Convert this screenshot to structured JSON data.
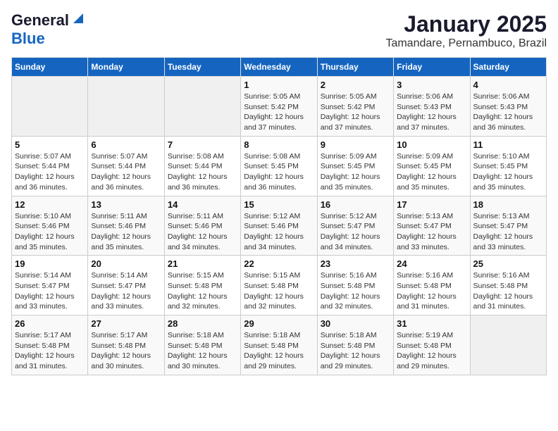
{
  "header": {
    "logo_line1": "General",
    "logo_line2": "Blue",
    "month": "January 2025",
    "location": "Tamandare, Pernambuco, Brazil"
  },
  "weekdays": [
    "Sunday",
    "Monday",
    "Tuesday",
    "Wednesday",
    "Thursday",
    "Friday",
    "Saturday"
  ],
  "weeks": [
    [
      {
        "day": "",
        "info": ""
      },
      {
        "day": "",
        "info": ""
      },
      {
        "day": "",
        "info": ""
      },
      {
        "day": "1",
        "info": "Sunrise: 5:05 AM\nSunset: 5:42 PM\nDaylight: 12 hours\nand 37 minutes."
      },
      {
        "day": "2",
        "info": "Sunrise: 5:05 AM\nSunset: 5:42 PM\nDaylight: 12 hours\nand 37 minutes."
      },
      {
        "day": "3",
        "info": "Sunrise: 5:06 AM\nSunset: 5:43 PM\nDaylight: 12 hours\nand 37 minutes."
      },
      {
        "day": "4",
        "info": "Sunrise: 5:06 AM\nSunset: 5:43 PM\nDaylight: 12 hours\nand 36 minutes."
      }
    ],
    [
      {
        "day": "5",
        "info": "Sunrise: 5:07 AM\nSunset: 5:44 PM\nDaylight: 12 hours\nand 36 minutes."
      },
      {
        "day": "6",
        "info": "Sunrise: 5:07 AM\nSunset: 5:44 PM\nDaylight: 12 hours\nand 36 minutes."
      },
      {
        "day": "7",
        "info": "Sunrise: 5:08 AM\nSunset: 5:44 PM\nDaylight: 12 hours\nand 36 minutes."
      },
      {
        "day": "8",
        "info": "Sunrise: 5:08 AM\nSunset: 5:45 PM\nDaylight: 12 hours\nand 36 minutes."
      },
      {
        "day": "9",
        "info": "Sunrise: 5:09 AM\nSunset: 5:45 PM\nDaylight: 12 hours\nand 35 minutes."
      },
      {
        "day": "10",
        "info": "Sunrise: 5:09 AM\nSunset: 5:45 PM\nDaylight: 12 hours\nand 35 minutes."
      },
      {
        "day": "11",
        "info": "Sunrise: 5:10 AM\nSunset: 5:45 PM\nDaylight: 12 hours\nand 35 minutes."
      }
    ],
    [
      {
        "day": "12",
        "info": "Sunrise: 5:10 AM\nSunset: 5:46 PM\nDaylight: 12 hours\nand 35 minutes."
      },
      {
        "day": "13",
        "info": "Sunrise: 5:11 AM\nSunset: 5:46 PM\nDaylight: 12 hours\nand 35 minutes."
      },
      {
        "day": "14",
        "info": "Sunrise: 5:11 AM\nSunset: 5:46 PM\nDaylight: 12 hours\nand 34 minutes."
      },
      {
        "day": "15",
        "info": "Sunrise: 5:12 AM\nSunset: 5:46 PM\nDaylight: 12 hours\nand 34 minutes."
      },
      {
        "day": "16",
        "info": "Sunrise: 5:12 AM\nSunset: 5:47 PM\nDaylight: 12 hours\nand 34 minutes."
      },
      {
        "day": "17",
        "info": "Sunrise: 5:13 AM\nSunset: 5:47 PM\nDaylight: 12 hours\nand 33 minutes."
      },
      {
        "day": "18",
        "info": "Sunrise: 5:13 AM\nSunset: 5:47 PM\nDaylight: 12 hours\nand 33 minutes."
      }
    ],
    [
      {
        "day": "19",
        "info": "Sunrise: 5:14 AM\nSunset: 5:47 PM\nDaylight: 12 hours\nand 33 minutes."
      },
      {
        "day": "20",
        "info": "Sunrise: 5:14 AM\nSunset: 5:47 PM\nDaylight: 12 hours\nand 33 minutes."
      },
      {
        "day": "21",
        "info": "Sunrise: 5:15 AM\nSunset: 5:48 PM\nDaylight: 12 hours\nand 32 minutes."
      },
      {
        "day": "22",
        "info": "Sunrise: 5:15 AM\nSunset: 5:48 PM\nDaylight: 12 hours\nand 32 minutes."
      },
      {
        "day": "23",
        "info": "Sunrise: 5:16 AM\nSunset: 5:48 PM\nDaylight: 12 hours\nand 32 minutes."
      },
      {
        "day": "24",
        "info": "Sunrise: 5:16 AM\nSunset: 5:48 PM\nDaylight: 12 hours\nand 31 minutes."
      },
      {
        "day": "25",
        "info": "Sunrise: 5:16 AM\nSunset: 5:48 PM\nDaylight: 12 hours\nand 31 minutes."
      }
    ],
    [
      {
        "day": "26",
        "info": "Sunrise: 5:17 AM\nSunset: 5:48 PM\nDaylight: 12 hours\nand 31 minutes."
      },
      {
        "day": "27",
        "info": "Sunrise: 5:17 AM\nSunset: 5:48 PM\nDaylight: 12 hours\nand 30 minutes."
      },
      {
        "day": "28",
        "info": "Sunrise: 5:18 AM\nSunset: 5:48 PM\nDaylight: 12 hours\nand 30 minutes."
      },
      {
        "day": "29",
        "info": "Sunrise: 5:18 AM\nSunset: 5:48 PM\nDaylight: 12 hours\nand 29 minutes."
      },
      {
        "day": "30",
        "info": "Sunrise: 5:18 AM\nSunset: 5:48 PM\nDaylight: 12 hours\nand 29 minutes."
      },
      {
        "day": "31",
        "info": "Sunrise: 5:19 AM\nSunset: 5:48 PM\nDaylight: 12 hours\nand 29 minutes."
      },
      {
        "day": "",
        "info": ""
      }
    ]
  ]
}
